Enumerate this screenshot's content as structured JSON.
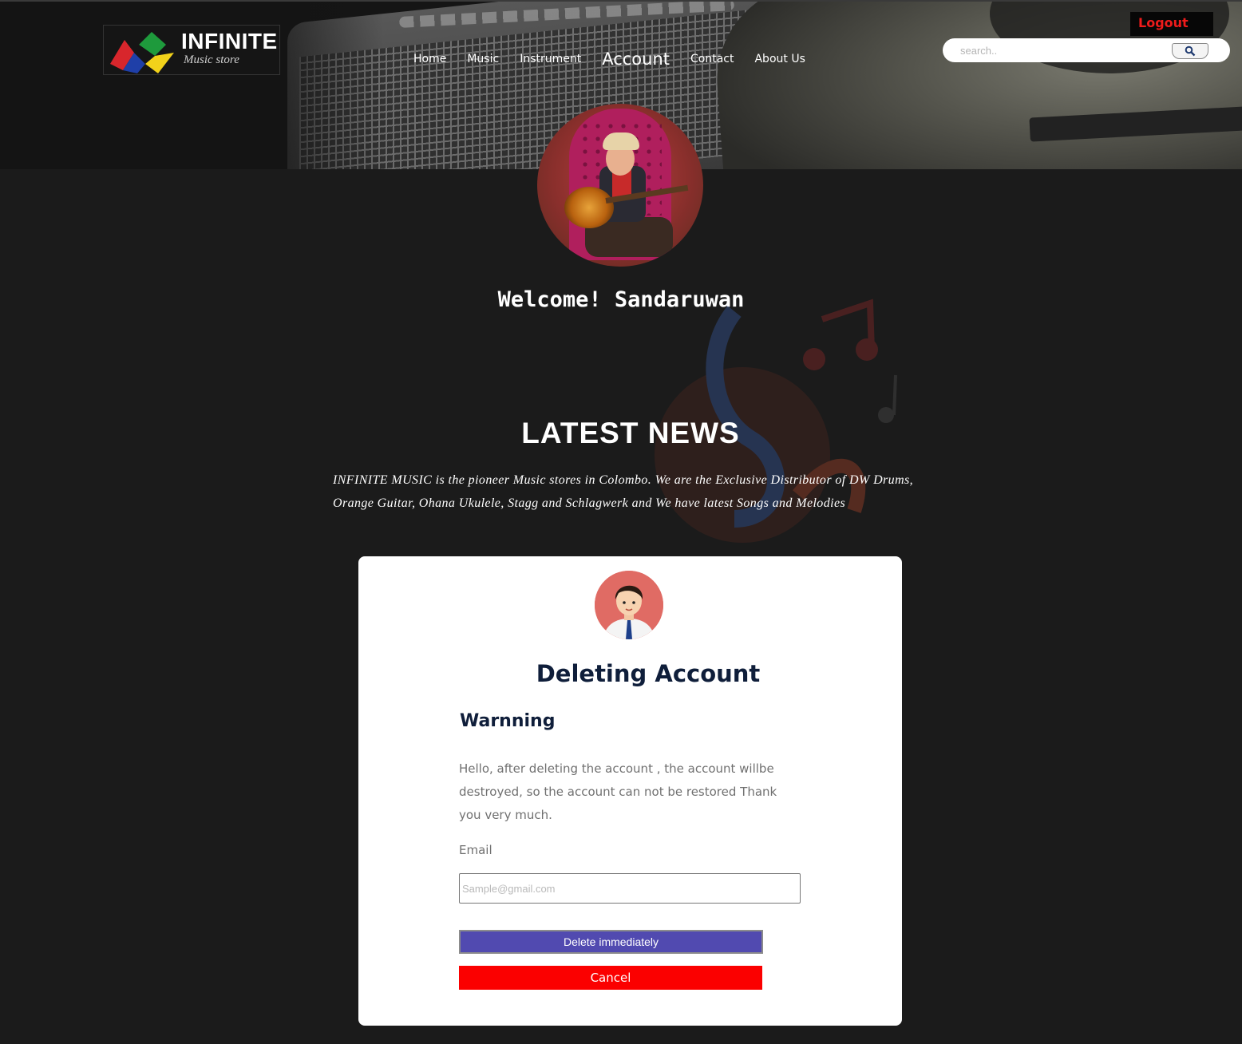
{
  "header": {
    "logo": {
      "title": "INFINITE",
      "subtitle": "Music store"
    },
    "nav": [
      {
        "label": "Home"
      },
      {
        "label": "Music"
      },
      {
        "label": "Instrument"
      },
      {
        "label": "Account",
        "active": true
      },
      {
        "label": "Contact"
      },
      {
        "label": "About Us"
      }
    ],
    "logout_label": "Logout",
    "search": {
      "placeholder": "search..",
      "value": ""
    }
  },
  "profile": {
    "welcome": "Welcome! Sandaruwan"
  },
  "news": {
    "title": "LATEST NEWS",
    "text": "INFINITE MUSIC is the pioneer Music stores in Colombo. We are the Exclusive Distributor of DW Drums, Orange Guitar, Ohana Ukulele, Stagg and Schlagwerk and We have latest Songs and Melodies"
  },
  "delete_card": {
    "title": "Deleting Account",
    "warning_heading": "Warnning",
    "message": "Hello, after deleting the account , the account willbe destroyed, so the account can not be restored Thank you very much.",
    "email_label": "Email",
    "email_placeholder": "Sample@gmail.com",
    "email_value": "",
    "delete_label": "Delete immediately",
    "cancel_label": "Cancel"
  },
  "colors": {
    "page_bg": "#1b1b1b",
    "logout_text": "#ef1b1b",
    "delete_button": "#514ab0",
    "cancel_button": "#fb0000",
    "card_heading": "#0f1e3a"
  },
  "icons": [
    "search-icon",
    "logo-mark-icon",
    "user-avatar-icon"
  ]
}
